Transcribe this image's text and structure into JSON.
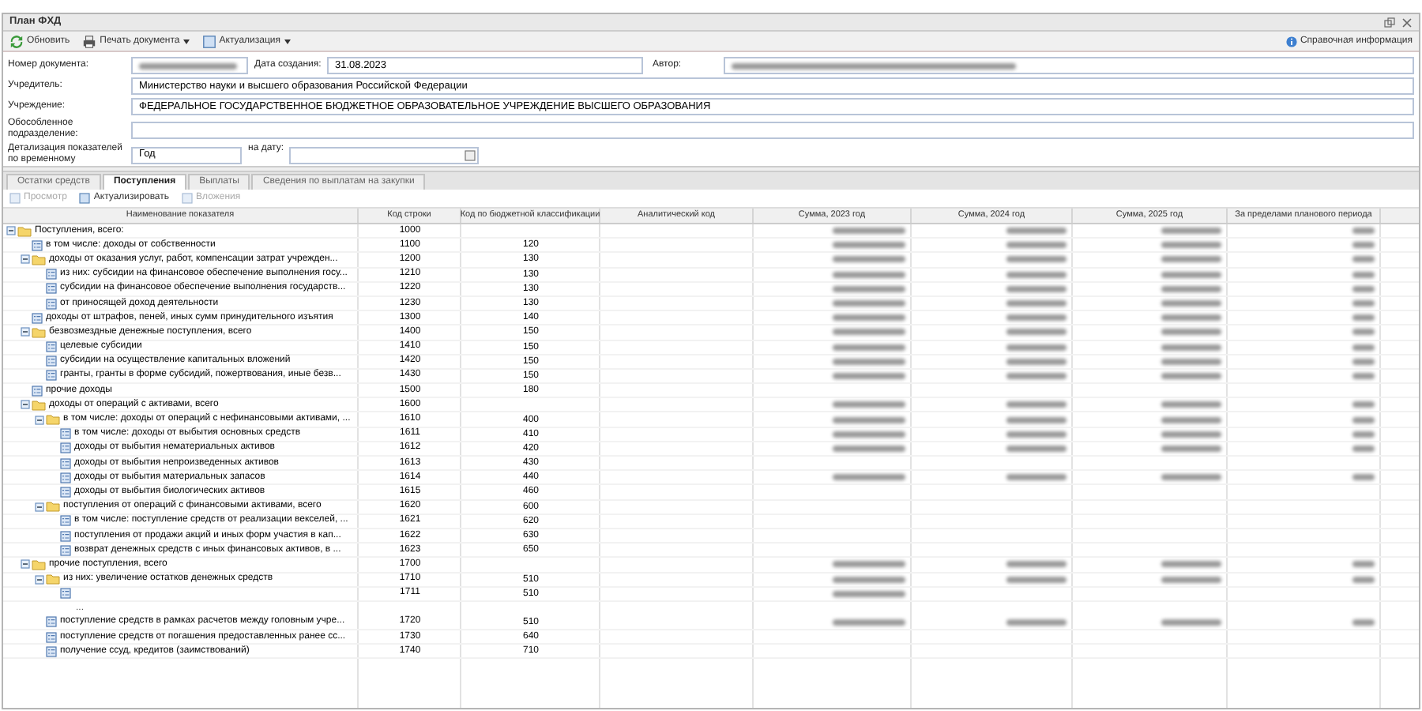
{
  "window": {
    "title": "План ФХД"
  },
  "toolbar": [
    {
      "label": "Обновить",
      "kind": "refresh",
      "dropdown": false
    },
    {
      "label": "Печать документа",
      "kind": "print",
      "dropdown": true
    },
    {
      "label": "Актуализация",
      "kind": "update",
      "dropdown": true
    }
  ],
  "help": "Справочная информация",
  "form": {
    "doc_number": {
      "label": "Номер документа:",
      "redacted": true
    },
    "created": {
      "label": "Дата создания:",
      "value": "31.08.2023"
    },
    "author": {
      "label": "Автор:",
      "redacted": true
    },
    "founder": {
      "label": "Учредитель:",
      "value": "Министерство науки и высшего образования Российской Федерации"
    },
    "institution": {
      "label": "Учреждение:",
      "value": "ФЕДЕРАЛЬНОЕ ГОСУДАРСТВЕННОЕ БЮДЖЕТНОЕ ОБРАЗОВАТЕЛЬНОЕ УЧРЕЖДЕНИЕ ВЫСШЕГО ОБРАЗОВАНИЯ"
    },
    "subdivision": {
      "label": "Обособленное подразделение:"
    },
    "detail": {
      "label": "Детализация показателей по временному",
      "value": "Год"
    },
    "on_date": {
      "label": "на дату:"
    }
  },
  "tabs": [
    {
      "label": "Остатки средств",
      "selected": false
    },
    {
      "label": "Поступления",
      "selected": true
    },
    {
      "label": "Выплаты",
      "selected": false
    },
    {
      "label": "Сведения по выплатам на закупки",
      "selected": false
    }
  ],
  "actions": [
    {
      "label": "Просмотр",
      "disabled": true
    },
    {
      "label": "Актуализировать",
      "disabled": false
    },
    {
      "label": "Вложения",
      "disabled": true
    }
  ],
  "table": {
    "columns": [
      "Наименование показателя",
      "Код строки",
      "Код по бюджетной классификации",
      "Аналитический код",
      "Сумма, 2023 год",
      "Сумма, 2024 год",
      "Сумма, 2025 год",
      "За пределами планового периода"
    ],
    "rows": [
      {
        "name": "Поступления, всего:",
        "code": "1000",
        "sums": [
          true,
          true,
          true,
          true
        ],
        "expanded": true,
        "children": [
          {
            "name": "в том числе: доходы от собственности",
            "code": "1100",
            "kbk": "120",
            "sums": [
              true,
              true,
              true,
              true
            ]
          },
          {
            "name": "доходы от оказания услуг, работ, компенсации затрат учрежден...",
            "code": "1200",
            "kbk": "130",
            "sums": [
              true,
              true,
              true,
              true
            ],
            "expanded": true,
            "children": [
              {
                "name": "из них: субсидии на финансовое обеспечение выполнения госу...",
                "code": "1210",
                "kbk": "130",
                "sums": [
                  true,
                  true,
                  true,
                  true
                ]
              },
              {
                "name": "субсидии на финансовое обеспечение выполнения государств...",
                "code": "1220",
                "kbk": "130",
                "sums": [
                  true,
                  true,
                  true,
                  true
                ]
              },
              {
                "name": "от приносящей доход деятельности",
                "code": "1230",
                "kbk": "130",
                "sums": [
                  true,
                  true,
                  true,
                  true
                ]
              }
            ]
          },
          {
            "name": "доходы от штрафов, пеней, иных сумм принудительного изъятия",
            "code": "1300",
            "kbk": "140",
            "sums": [
              true,
              true,
              true,
              true
            ]
          },
          {
            "name": "безвозмездные денежные поступления, всего",
            "code": "1400",
            "kbk": "150",
            "sums": [
              true,
              true,
              true,
              true
            ],
            "expanded": true,
            "children": [
              {
                "name": "целевые субсидии",
                "code": "1410",
                "kbk": "150",
                "sums": [
                  true,
                  true,
                  true,
                  true
                ]
              },
              {
                "name": "субсидии на осуществление капитальных вложений",
                "code": "1420",
                "kbk": "150",
                "sums": [
                  true,
                  true,
                  true,
                  true
                ]
              },
              {
                "name": "гранты, гранты в форме субсидий, пожертвования, иные безв...",
                "code": "1430",
                "kbk": "150",
                "sums": [
                  true,
                  true,
                  true,
                  true
                ]
              }
            ]
          },
          {
            "name": "прочие доходы",
            "code": "1500",
            "kbk": "180",
            "sums": [
              false,
              false,
              false,
              false
            ]
          },
          {
            "name": "доходы от операций с активами, всего",
            "code": "1600",
            "sums": [
              true,
              true,
              true,
              true
            ],
            "expanded": true,
            "children": [
              {
                "name": "в том числе: доходы от операций с нефинансовыми активами, ...",
                "code": "1610",
                "kbk": "400",
                "sums": [
                  true,
                  true,
                  true,
                  true
                ],
                "expanded": true,
                "children": [
                  {
                    "name": "в том числе: доходы от выбытия основных средств",
                    "code": "1611",
                    "kbk": "410",
                    "sums": [
                      true,
                      true,
                      true,
                      true
                    ]
                  },
                  {
                    "name": "доходы от выбытия нематериальных активов",
                    "code": "1612",
                    "kbk": "420",
                    "sums": [
                      true,
                      true,
                      true,
                      true
                    ]
                  },
                  {
                    "name": "доходы от выбытия непроизведенных активов",
                    "code": "1613",
                    "kbk": "430",
                    "sums": [
                      false,
                      false,
                      false,
                      false
                    ]
                  },
                  {
                    "name": "доходы от выбытия материальных запасов",
                    "code": "1614",
                    "kbk": "440",
                    "sums": [
                      true,
                      true,
                      true,
                      true
                    ]
                  },
                  {
                    "name": "доходы от выбытия биологических активов",
                    "code": "1615",
                    "kbk": "460",
                    "sums": [
                      false,
                      false,
                      false,
                      false
                    ]
                  }
                ]
              },
              {
                "name": "поступления от операций с финансовыми активами, всего",
                "code": "1620",
                "kbk": "600",
                "sums": [
                  false,
                  false,
                  false,
                  false
                ],
                "expanded": true,
                "children": [
                  {
                    "name": "в том числе: поступление средств от реализации векселей, ...",
                    "code": "1621",
                    "kbk": "620",
                    "sums": [
                      false,
                      false,
                      false,
                      false
                    ]
                  },
                  {
                    "name": "поступления от продажи акций и иных форм участия в кап...",
                    "code": "1622",
                    "kbk": "630",
                    "sums": [
                      false,
                      false,
                      false,
                      false
                    ]
                  },
                  {
                    "name": "возврат денежных средств с иных финансовых активов, в ...",
                    "code": "1623",
                    "kbk": "650",
                    "sums": [
                      false,
                      false,
                      false,
                      false
                    ]
                  }
                ]
              }
            ]
          },
          {
            "name": "прочие поступления, всего",
            "code": "1700",
            "sums": [
              true,
              true,
              true,
              true
            ],
            "expanded": true,
            "children": [
              {
                "name": "из них: увеличение остатков денежных средств",
                "code": "1710",
                "kbk": "510",
                "sums": [
                  true,
                  true,
                  true,
                  true
                ],
                "expanded": true,
                "children": [
                  {
                    "code": "1711",
                    "kbk": "510",
                    "sums": [
                      true,
                      false,
                      false,
                      false
                    ],
                    "note": "..."
                  }
                ]
              },
              {
                "name": "поступление средств в рамках расчетов между головным учре...",
                "code": "1720",
                "kbk": "510",
                "sums": [
                  true,
                  true,
                  true,
                  true
                ]
              },
              {
                "name": "поступление средств от погашения предоставленных ранее сс...",
                "code": "1730",
                "kbk": "640",
                "sums": [
                  false,
                  false,
                  false,
                  false
                ]
              },
              {
                "name": "получение ссуд, кредитов (заимствований)",
                "code": "1740",
                "kbk": "710",
                "sums": [
                  false,
                  false,
                  false,
                  false
                ]
              }
            ]
          }
        ]
      }
    ]
  }
}
